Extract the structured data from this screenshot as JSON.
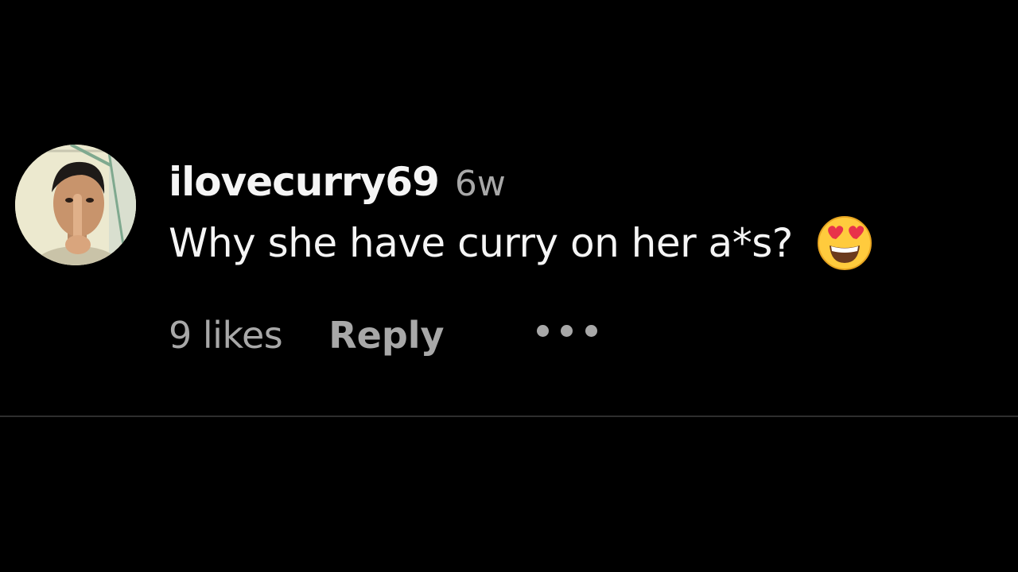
{
  "comment": {
    "username": "ilovecurry69",
    "timestamp": "6w",
    "text": "Why she have curry on her a*s?",
    "emoji": "smiling-face-with-heart-eyes",
    "likes": "9 likes",
    "reply_label": "Reply",
    "more_icon": "more-options-icon"
  },
  "colors": {
    "background": "#000000",
    "primary_text": "#f5f5f5",
    "secondary_text": "#a8a8a8",
    "divider": "#2e2e2e"
  }
}
